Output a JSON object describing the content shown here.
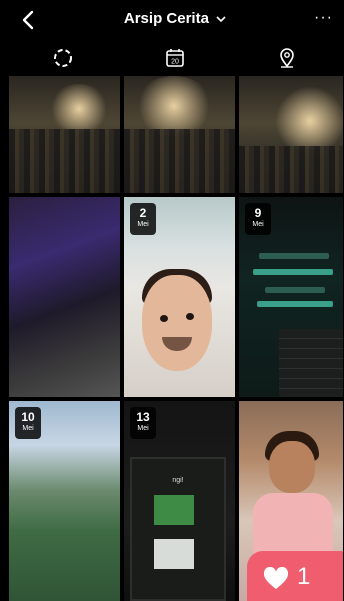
{
  "header": {
    "title": "Arsip Cerita",
    "more_label": "···"
  },
  "tabs": [
    {
      "icon": "stories-circle-icon"
    },
    {
      "icon": "calendar-icon",
      "text": "20"
    },
    {
      "icon": "location-pin-icon"
    }
  ],
  "grid": {
    "tiles": [
      {
        "day": "",
        "month": ""
      },
      {
        "day": "",
        "month": ""
      },
      {
        "day": "",
        "month": ""
      },
      {
        "day": "",
        "month": ""
      },
      {
        "day": "2",
        "month": "Mei"
      },
      {
        "day": "9",
        "month": "Mei"
      },
      {
        "day": "10",
        "month": "Mei"
      },
      {
        "day": "13",
        "month": "Mei"
      },
      {
        "day": "",
        "month": ""
      }
    ],
    "screen_text": "ngi!"
  },
  "like": {
    "count": "1",
    "color": "#f05d6e"
  }
}
